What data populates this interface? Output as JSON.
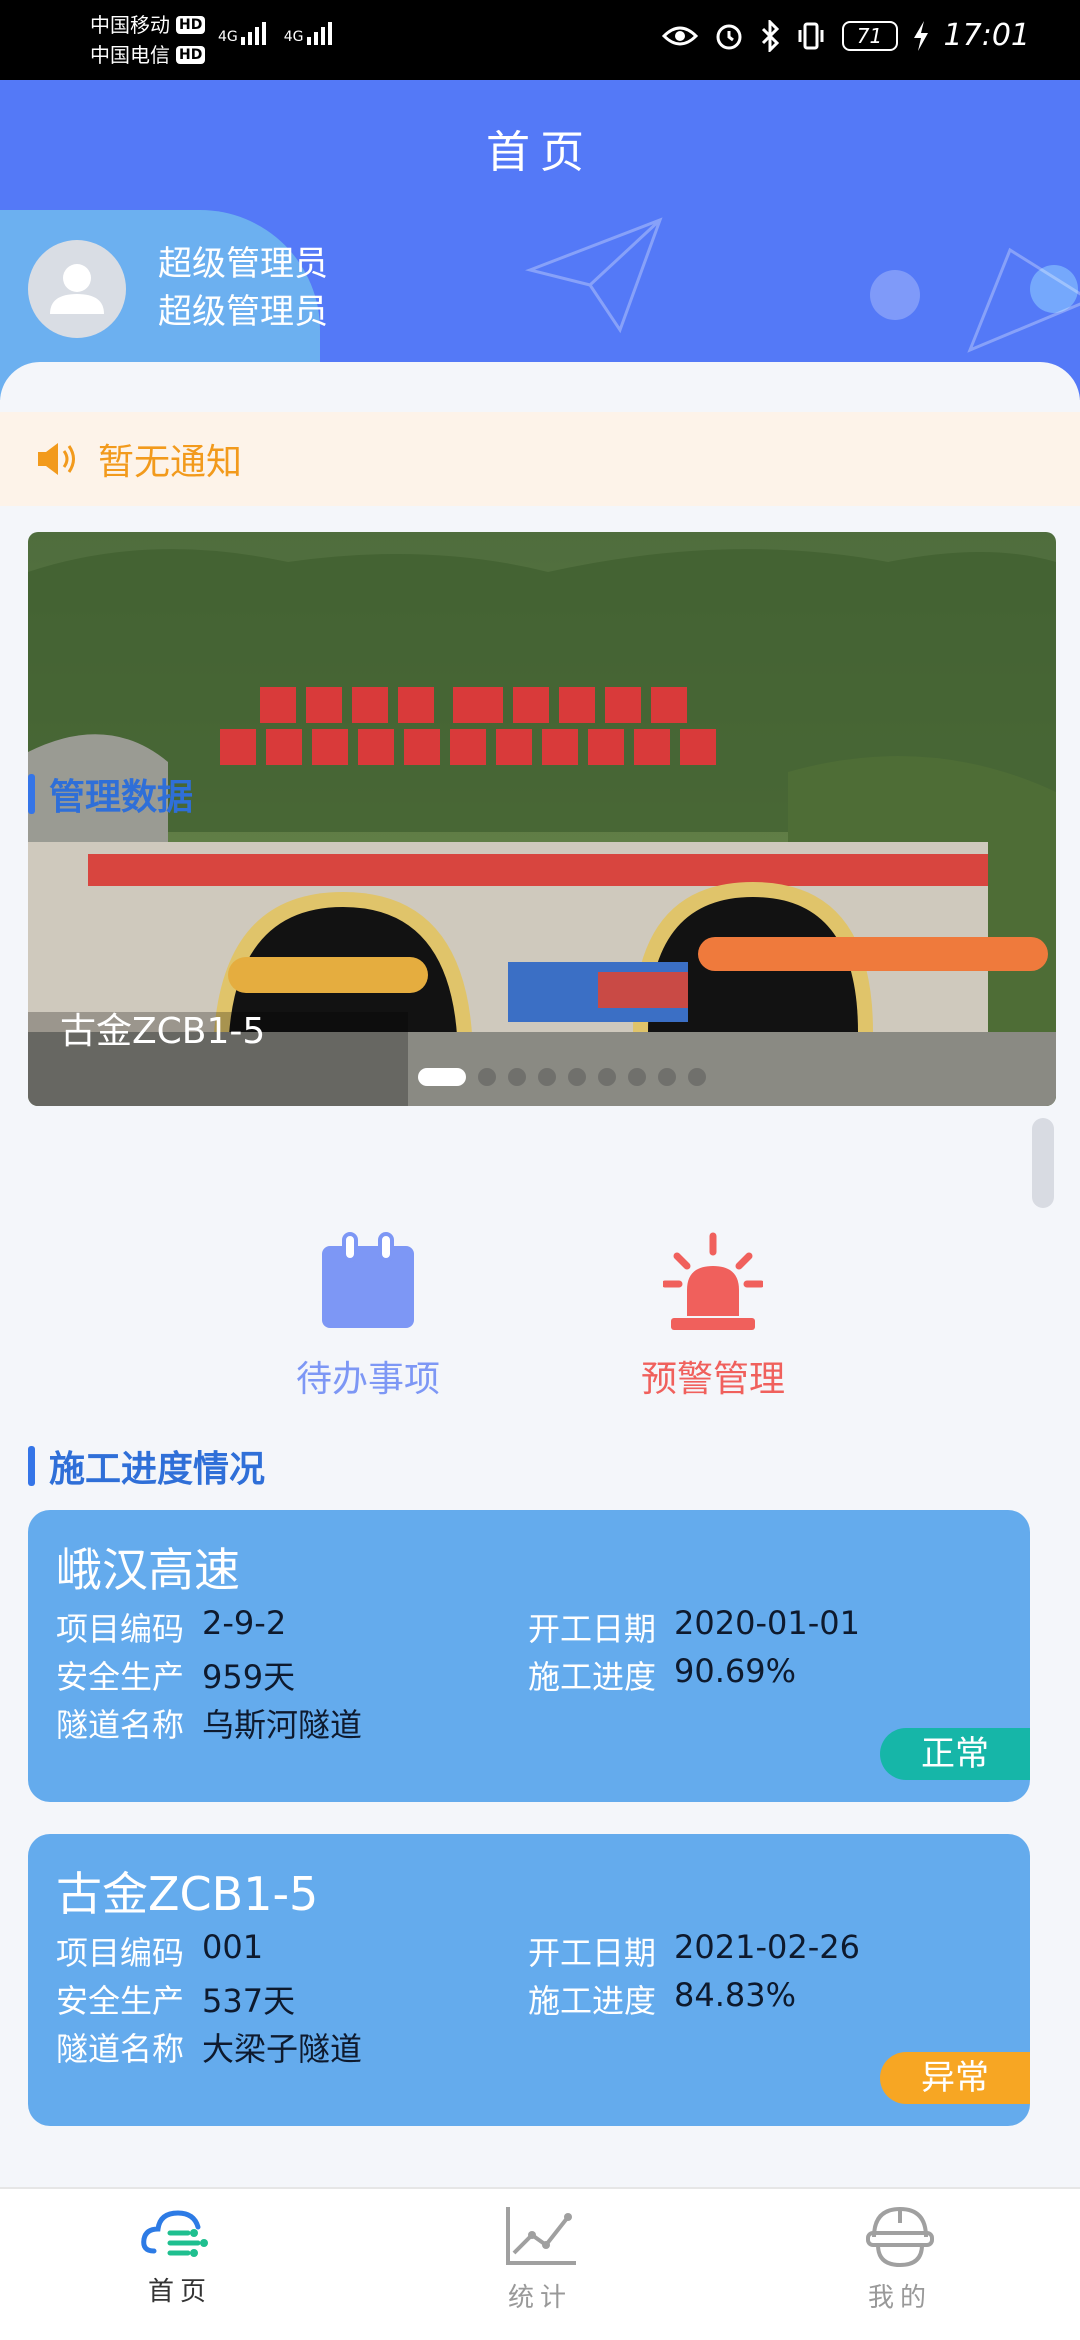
{
  "status_bar": {
    "carrier1": "中国移动",
    "carrier2": "中国电信",
    "hd": "HD",
    "network": "4G",
    "battery": "71",
    "time": "17:01"
  },
  "header": {
    "title": "首页",
    "user_role": "超级管理员",
    "user_name": "超级管理员"
  },
  "notice": {
    "text": "暂无通知"
  },
  "banner": {
    "caption": "古金ZCB1-5",
    "slide_count": 10,
    "active_slide": 1
  },
  "sections": {
    "management": "管理数据",
    "progress": "施工进度情况"
  },
  "management_items": [
    {
      "label": "待办事项",
      "icon": "calendar-icon",
      "color": "#7d97f5"
    },
    {
      "label": "预警管理",
      "icon": "alarm-light-icon",
      "color": "#f0605c"
    }
  ],
  "field_labels": {
    "code": "项目编码",
    "start_date": "开工日期",
    "safety": "安全生产",
    "progress": "施工进度",
    "tunnel": "隧道名称"
  },
  "projects": [
    {
      "name": "峨汉高速",
      "code": "2-9-2",
      "start_date": "2020-01-01",
      "safety": "959天",
      "progress": "90.69%",
      "tunnel": "乌斯河隧道",
      "status": "正常"
    },
    {
      "name": "古金ZCB1-5",
      "code": "001",
      "start_date": "2021-02-26",
      "safety": "537天",
      "progress": "84.83%",
      "tunnel": "大梁子隧道",
      "status": "异常"
    }
  ],
  "bottom_nav": [
    {
      "label": "首页",
      "icon": "home-cloud-icon",
      "active": true
    },
    {
      "label": "统计",
      "icon": "chart-line-icon",
      "active": false
    },
    {
      "label": "我的",
      "icon": "helmet-icon",
      "active": false
    }
  ],
  "colors": {
    "header_blue": "#5479f7",
    "card_blue": "#64abed",
    "status_ok": "#16b6a8",
    "status_warn": "#f7a623",
    "notice_orange": "#f29a1c"
  }
}
